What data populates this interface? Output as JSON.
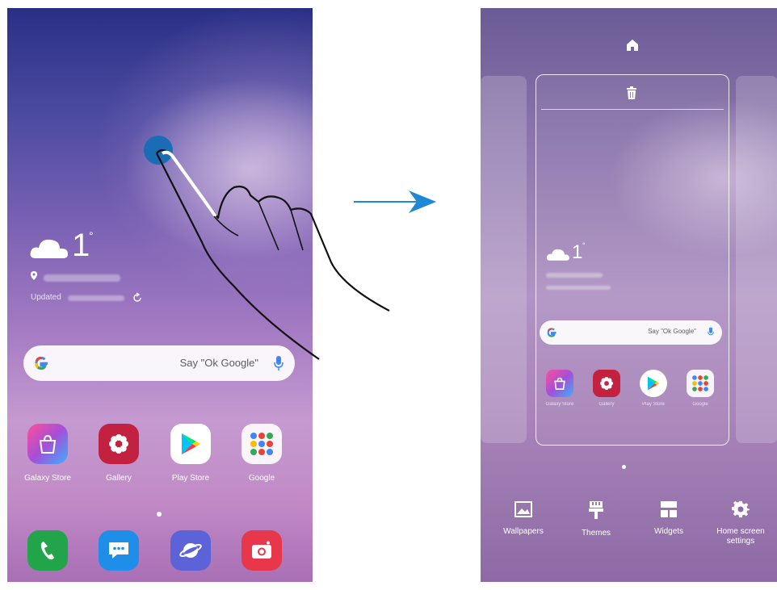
{
  "left_screen": {
    "weather": {
      "temperature": "1",
      "degree": "°",
      "updated_label": "Updated"
    },
    "search": {
      "placeholder": "Say \"Ok Google\""
    },
    "apps": [
      {
        "label": "Galaxy Store",
        "icon": "galaxy-store-icon"
      },
      {
        "label": "Gallery",
        "icon": "gallery-icon"
      },
      {
        "label": "Play Store",
        "icon": "play-store-icon"
      },
      {
        "label": "Google",
        "icon": "google-folder-icon"
      }
    ],
    "dock": [
      {
        "icon": "phone-icon"
      },
      {
        "icon": "messages-icon"
      },
      {
        "icon": "internet-icon"
      },
      {
        "icon": "camera-icon"
      }
    ]
  },
  "right_screen": {
    "weather": {
      "temperature": "1",
      "degree": "°"
    },
    "search": {
      "placeholder": "Say \"Ok Google\""
    },
    "apps": [
      {
        "label": "Galaxy Store"
      },
      {
        "label": "Gallery"
      },
      {
        "label": "Play Store"
      },
      {
        "label": "Google"
      }
    ],
    "menu": [
      {
        "label": "Wallpapers",
        "icon": "wallpapers-icon"
      },
      {
        "label": "Themes",
        "icon": "themes-icon"
      },
      {
        "label": "Widgets",
        "icon": "widgets-icon"
      },
      {
        "label": "Home screen settings",
        "icon": "settings-icon"
      }
    ]
  },
  "colors": {
    "arrow": "#1e88d6",
    "touch_dot": "#1a6db5"
  }
}
